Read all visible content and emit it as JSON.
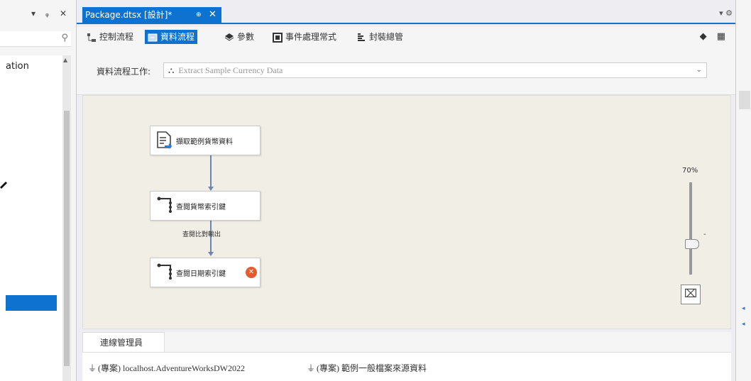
{
  "left_panel": {
    "title_controls": {
      "dropdown": "▾",
      "pin": "ᵩ",
      "close": "✕"
    },
    "item_label": "ation"
  },
  "document": {
    "tab_title": "Package.dtsx [設計]*",
    "tab_pin": "⊕",
    "tab_close": "✕",
    "tabstrip_controls": "▾ ⚙",
    "toolbar": {
      "control_flow": "控制流程",
      "data_flow": "資料流程",
      "parameters": "參數",
      "event_handlers": "事件處理常式",
      "package_explorer": "封裝總管"
    },
    "task_label": "資料流程工作:",
    "task_value": "Extract Sample Currency Data",
    "canvas": {
      "nodes": [
        {
          "label": "擷取範例貨幣資料",
          "type": "source"
        },
        {
          "label": "查閱貨幣索引鍵",
          "type": "lookup"
        },
        {
          "label": "查閱日期索引鍵",
          "type": "lookup",
          "error": true
        }
      ],
      "path_label": "查閱比對輸出",
      "zoom_label": "70%",
      "zoom_tick": "-"
    },
    "connection_manager": {
      "tab": "連線管理員",
      "items": [
        "(專案) localhost.AdventureWorksDW2022",
        "(專案) 範例一般檔案來源資料"
      ]
    }
  }
}
